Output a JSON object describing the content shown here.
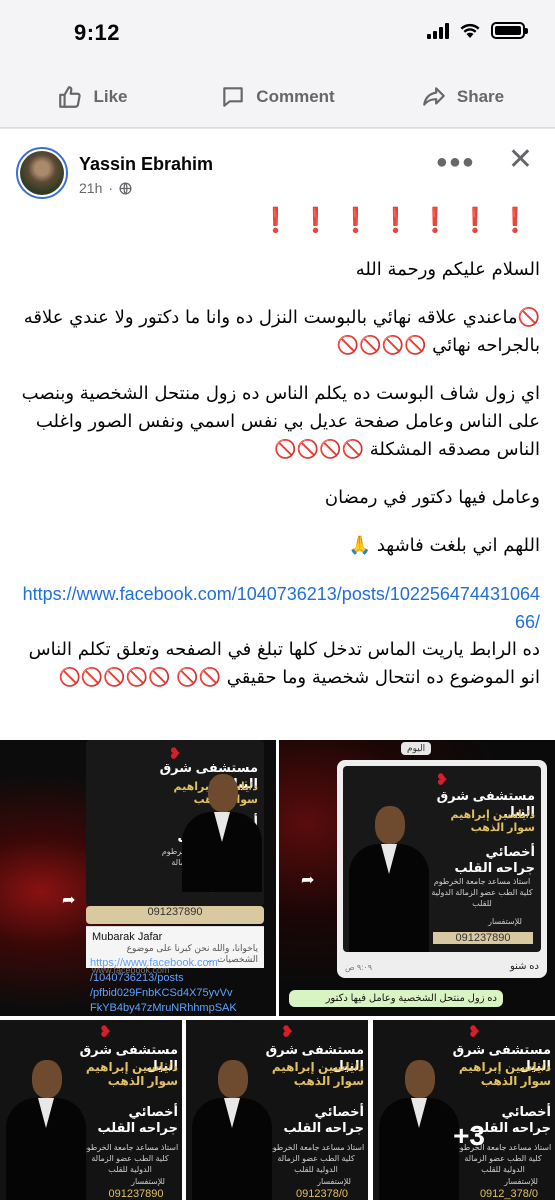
{
  "status": {
    "time": "9:12"
  },
  "actions": {
    "like": "Like",
    "comment": "Comment",
    "share": "Share"
  },
  "post": {
    "author": "Yassin Ebrahim",
    "time": "21h",
    "exclamations": "❗❗❗❗❗❗❗",
    "greeting": "السلام عليكم ورحمة الله",
    "para1": "🚫ماعندي علاقه نهائي بالبوست النزل ده وانا ما دكتور ولا عندي علاقه بالجراحه نهائي 🚫🚫🚫🚫",
    "para2": "اي زول شاف البوست ده يكلم الناس ده زول منتحل الشخصية وبنصب على الناس وعامل صفحة عديل بي نفس اسمي ونفس الصور واغلب الناس مصدقه المشكلة 🚫🚫🚫🚫",
    "para3": "وعامل فيها دكتور في رمضان",
    "para4": "اللهم اني بلغت فاشهد 🙏",
    "link": "https://www.facebook.com/1040736213/posts/10225647443106466/",
    "para5": "ده الرابط ياريت الماس تدخل كلها تبلغ في الصفحه وتعلق تكلم الناس انو الموضوع ده انتحال شخصية وما حقيقي 🚫🚫 🚫🚫🚫🚫🚫"
  },
  "media": {
    "poster": {
      "hospital": "مستشفى شرق النيل",
      "doctor": "د/ياسين إبراهيم سوار الذهب",
      "specialty": "أخصائي جراحه القلب",
      "desc": "استاذ مساعد جامعة الخرطوم كلية الطب عضو الزمالة الدولية للقلب",
      "inquiry": "للإستفسار",
      "phone": "091237890",
      "phone_cut": "0912378/0",
      "phone_cut2": "0912_378/0"
    },
    "card": {
      "name": "Mubarak Jafar",
      "snippet": "ياخوانا، والله نحن كبرنا على موضوع الشخصيات ...",
      "domain": "www.facebook.com"
    },
    "link_lines": [
      "https://www.facebook.com",
      "/1040736213/posts",
      "/pfbid029FnbKCSd4X75yvVv",
      "FkYB4by47zMruNRhhmpSAK"
    ],
    "chat": {
      "day": "اليوم",
      "caption": "ده شنو",
      "time": "٩:٠٩ ص",
      "reply": "ده زول منتحل الشخصية وعامل فيها دكتور"
    },
    "more_count": "+3"
  },
  "colors": {
    "link": "#216fdb",
    "icon": "#65676b",
    "alert": "#d0212a"
  }
}
